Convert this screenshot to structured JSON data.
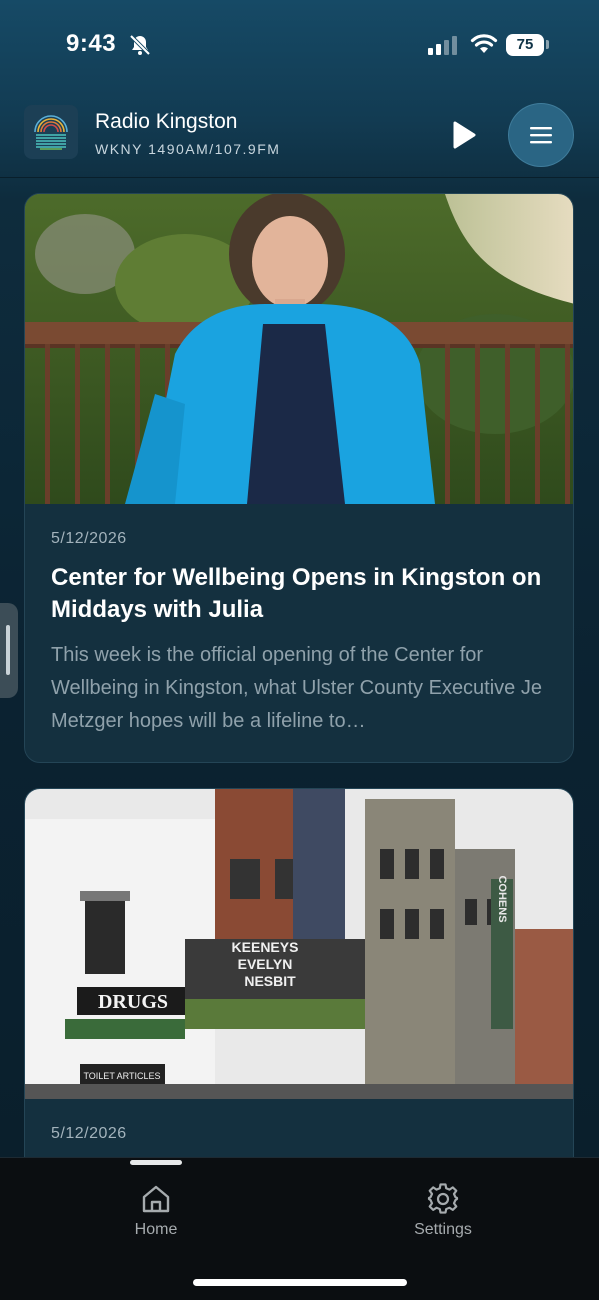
{
  "status_bar": {
    "time": "9:43",
    "battery": "75",
    "icons": [
      "bell-slash-icon",
      "signal-icon",
      "wifi-icon",
      "battery-icon"
    ]
  },
  "header": {
    "station_name": "Radio Kingston",
    "station_frequency": "WKNY 1490AM/107.9FM",
    "play_icon": "play-icon",
    "menu_icon": "hamburger-menu-icon"
  },
  "articles": [
    {
      "date": "5/12/2026",
      "title": "Center for Wellbeing Opens in Kingston on Middays with Julia",
      "summary": "This week is the official opening of the Center for Wellbeing in Kingston, what Ulster County Executive Je Metzger hopes will be a lifeline to…",
      "image": "portrait-woman-blue-blazer"
    },
    {
      "date": "5/12/2026",
      "title": "",
      "summary": "",
      "image": "historic-street-storefronts",
      "signs": [
        "DRUGS",
        "KEENEYS",
        "EVELYN",
        "NESBIT",
        "TOILET ARTICLES",
        "COHENS"
      ]
    }
  ],
  "tab_bar": {
    "tabs": [
      {
        "label": "Home",
        "icon": "home-icon",
        "active": true
      },
      {
        "label": "Settings",
        "icon": "gear-icon",
        "active": false
      }
    ]
  },
  "colors": {
    "header_bg": "#164a66",
    "content_bg": "#0b2231",
    "card_bg": "#14303f",
    "tab_bar_bg": "#0b0e11",
    "accent": "#2a6584"
  }
}
